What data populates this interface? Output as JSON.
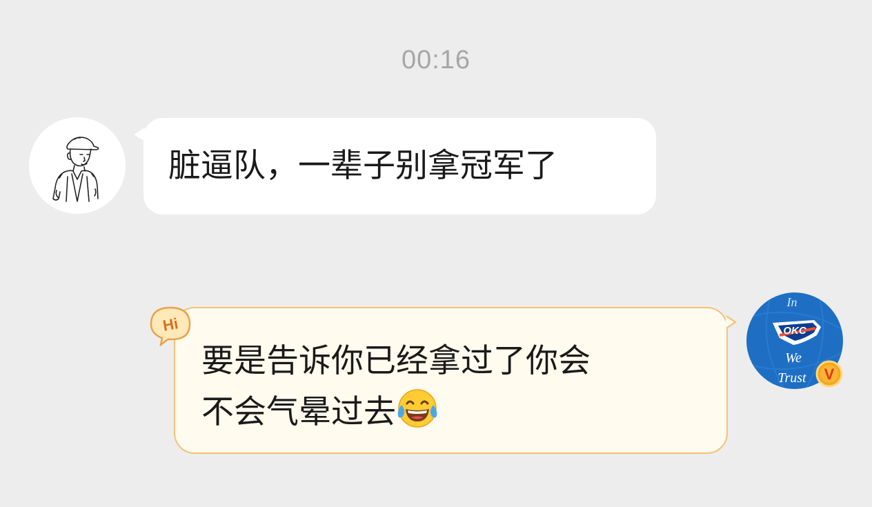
{
  "timestamp": "00:16",
  "messages": [
    {
      "side": "left",
      "avatar": "sketch-boy-avatar",
      "text": "脏逼队，一辈子别拿冠军了"
    },
    {
      "side": "right",
      "avatar": "okc-logo-avatar",
      "badge": "Hi",
      "text_line1": "要是告诉你已经拿过了你会",
      "text_line2": "不会气晕过去",
      "emoji": "tears-of-joy-emoji"
    }
  ],
  "avatar_right": {
    "text_top": "In",
    "logo_text": "OKC",
    "text_mid": "We",
    "text_bottom": "Trust",
    "verified_badge": "V"
  },
  "colors": {
    "background": "#ededed",
    "timestamp": "#a6a6a6",
    "bubble_left": "#ffffff",
    "bubble_right_fill": "#fffbee",
    "bubble_right_border": "#f4c277",
    "okc_blue": "#1e6fc4",
    "okc_orange": "#f05133",
    "verified": "#f5a623"
  }
}
